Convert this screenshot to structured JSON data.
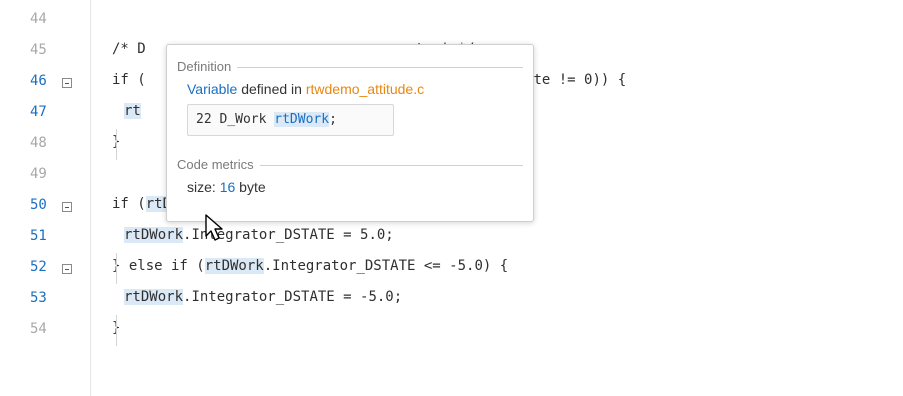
{
  "editor": {
    "lines": [
      {
        "num": "44",
        "link": false,
        "fold": false,
        "code": []
      },
      {
        "num": "45",
        "link": false,
        "fold": false,
        "code": [
          {
            "t": "/* D",
            "hl": false
          },
          {
            "t": "                            ",
            "hl": false
          },
          {
            "t": "egrator' */",
            "hl": false
          }
        ]
      },
      {
        "num": "46",
        "link": true,
        "fold": true,
        "code": [
          {
            "t": "if (",
            "hl": false
          },
          {
            "t": "                          ",
            "hl": false
          },
          {
            "t": "egrator_PrevResetState != 0)) {",
            "hl": false
          }
        ]
      },
      {
        "num": "47",
        "link": true,
        "fold": false,
        "code": [
          {
            "t": "rt",
            "hl": true
          }
        ]
      },
      {
        "num": "48",
        "link": false,
        "fold": false,
        "code": [
          {
            "t": "}",
            "hl": false
          }
        ]
      },
      {
        "num": "49",
        "link": false,
        "fold": false,
        "code": []
      },
      {
        "num": "50",
        "link": true,
        "fold": true,
        "code": [
          {
            "t": "if (",
            "hl": false
          },
          {
            "t": "rtDWork",
            "hl": true
          },
          {
            "t": ".Integrator_DSTATE >= 5.0) {",
            "hl": false
          }
        ]
      },
      {
        "num": "51",
        "link": true,
        "fold": false,
        "code": [
          {
            "t": "rtDWork",
            "hl": true
          },
          {
            "t": ".Integrator_DSTATE = 5.0;",
            "hl": false
          }
        ]
      },
      {
        "num": "52",
        "link": true,
        "fold": true,
        "code": [
          {
            "t": "} else if (",
            "hl": false
          },
          {
            "t": "rtDWork",
            "hl": true
          },
          {
            "t": ".Integrator_DSTATE <= -5.0) {",
            "hl": false
          }
        ]
      },
      {
        "num": "53",
        "link": true,
        "fold": false,
        "code": [
          {
            "t": "rtDWork",
            "hl": true
          },
          {
            "t": ".Integrator_DSTATE = -5.0;",
            "hl": false
          }
        ]
      },
      {
        "num": "54",
        "link": false,
        "fold": false,
        "code": [
          {
            "t": "}",
            "hl": false
          }
        ]
      }
    ]
  },
  "popup": {
    "definition_header": "Definition",
    "kind": "Variable",
    "defined_in": " defined in ",
    "file": "rtwdemo_attitude.c",
    "snippet_line": "22",
    "snippet_type": "D_Work",
    "snippet_symbol": "rtDWork",
    "snippet_end": ";",
    "metrics_header": "Code metrics",
    "size_label": "size: ",
    "size_value": "16",
    "size_unit": " byte"
  },
  "colors": {
    "link": "#1a6fc2",
    "file": "#e8870e",
    "highlight": "#dbe9f7"
  }
}
